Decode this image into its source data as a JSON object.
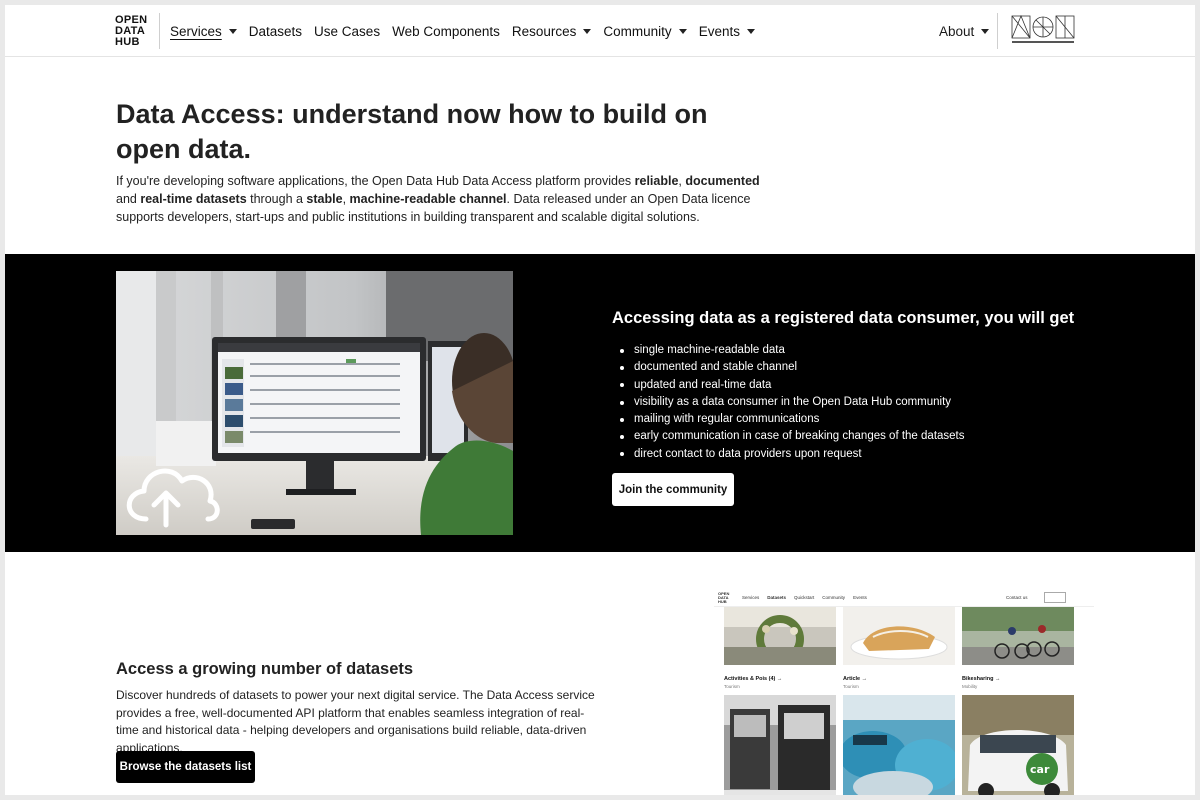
{
  "nav": {
    "logo_lines": [
      "OPEN",
      "DATA",
      "HUB"
    ],
    "items": [
      {
        "label": "Services",
        "dropdown": true,
        "active": true
      },
      {
        "label": "Datasets",
        "dropdown": false
      },
      {
        "label": "Use Cases",
        "dropdown": false
      },
      {
        "label": "Web Components",
        "dropdown": false
      },
      {
        "label": "Resources",
        "dropdown": true
      },
      {
        "label": "Community",
        "dropdown": true
      },
      {
        "label": "Events",
        "dropdown": true
      }
    ],
    "about_label": "About"
  },
  "hero": {
    "title": "Data Access: understand now how to build on open data.",
    "text_parts": [
      {
        "t": "If you're developing software applications, the Open Data Hub Data Access platform provides ",
        "b": false
      },
      {
        "t": "reliable",
        "b": true
      },
      {
        "t": ", ",
        "b": false
      },
      {
        "t": "documented",
        "b": true
      },
      {
        "t": " and ",
        "b": false
      },
      {
        "t": "real-time datasets",
        "b": true
      },
      {
        "t": " through a ",
        "b": false
      },
      {
        "t": "stable",
        "b": true
      },
      {
        "t": ", ",
        "b": false
      },
      {
        "t": "machine-readable channel",
        "b": true
      },
      {
        "t": ". Data released under an Open Data licence supports developers, start-ups and public institutions in building transparent and scalable digital solutions.",
        "b": false
      }
    ]
  },
  "consumer": {
    "title": "Accessing data as a registered data consumer, you will get",
    "benefits": [
      "single machine-readable data",
      "documented and stable channel",
      "updated and real-time data",
      "visibility as a data consumer in the Open Data Hub community",
      "mailing with regular communications",
      "early communication in case of breaking changes of the datasets",
      "direct contact to data providers upon request"
    ],
    "button_label": "Join the community"
  },
  "datasets": {
    "title": "Access a growing number of datasets",
    "text": "Discover hundreds of datasets to power your next digital service. The Data Access service provides a free, well-documented API platform that enables seamless integration of real-time and historical data - helping developers and organisations build reliable, data-driven applications.",
    "button_label": "Browse the datasets list"
  },
  "mini": {
    "logo_lines": [
      "OPEN",
      "DATA",
      "HUB"
    ],
    "menu": [
      "Services",
      "Datasets",
      "Quickstart",
      "Community",
      "Events"
    ],
    "contact": "Contact us",
    "cards": [
      {
        "title": "Activities & Pois (4) →",
        "sub": "Tourism"
      },
      {
        "title": "Article →",
        "sub": "Tourism"
      },
      {
        "title": "Bikesharing →",
        "sub": "Mobility"
      }
    ],
    "car_label": "car"
  },
  "colors": {
    "band": "#000000",
    "accent_green": "#3d8a3a",
    "text": "#222222"
  }
}
